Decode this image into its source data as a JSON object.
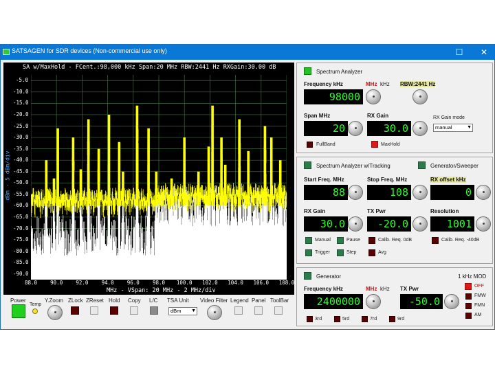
{
  "window": {
    "title": "SATSAGEN for SDR devices (Non-commercial use only)"
  },
  "colors": {
    "titlebar": "#0a78d7",
    "trace_maxhold": "#ffff00",
    "trace_live": "#ffffff",
    "grid": "#3a6e3a",
    "lcd_text": "#2cff2c",
    "accent_red": "#d01010"
  },
  "scope": {
    "title": "SA w/MaxHold - FCent.:98,000 kHz Span:20 MHz RBW:2441 Hz RXGain:30.00 dB",
    "y_axis_title": "dBm - 5 dBm/div",
    "x_axis_title": "MHz - VSpan: 20 MHz - 2 MHz/div",
    "y_ticks": [
      "-5.0",
      "-10.0",
      "-15.0",
      "-20.0",
      "-25.0",
      "-30.0",
      "-35.0",
      "-40.0",
      "-45.0",
      "-50.0",
      "-55.0",
      "-60.0",
      "-65.0",
      "-70.0",
      "-75.0",
      "-80.0",
      "-85.0",
      "-90.0"
    ],
    "x_ticks": [
      "88.0",
      "90.0",
      "92.0",
      "94.0",
      "96.0",
      "98.0",
      "100.0",
      "102.0",
      "104.0",
      "106.0",
      "108.0"
    ]
  },
  "chart_data": {
    "type": "line",
    "title": "SA w/MaxHold - FCent.:98,000 kHz Span:20 MHz RBW:2441 Hz RXGain:30.00 dB",
    "xlabel": "MHz - VSpan: 20 MHz - 2 MHz/div",
    "ylabel": "dBm - 5 dBm/div",
    "xlim": [
      88.0,
      108.0
    ],
    "ylim": [
      -92.5,
      -2.5
    ],
    "grid": true,
    "series": [
      {
        "values_x": [
          88.0,
          89.2,
          89.8,
          90.1,
          90.5,
          91.3,
          91.9,
          92.5,
          93.3,
          94.1,
          94.9,
          95.2,
          96.3,
          97.2,
          97.8,
          98.3,
          99.0,
          100.0,
          101.1,
          101.9,
          102.2,
          102.9,
          103.2,
          104.3,
          105.0,
          106.3,
          106.8,
          107.5,
          108.0
        ],
        "values_y": [
          -55,
          -40,
          -48,
          -26,
          -55,
          -30,
          -44,
          -22,
          -35,
          -20,
          -32,
          -45,
          -16,
          -26,
          -45,
          -56,
          -48,
          -30,
          -45,
          -34,
          -16,
          -30,
          -42,
          -22,
          -36,
          -25,
          -30,
          -40,
          -58
        ]
      }
    ]
  },
  "toolbar": {
    "items": [
      {
        "label": "Power"
      },
      {
        "label": "Temp"
      },
      {
        "label": "Y.Zoom"
      },
      {
        "label": "ZLock"
      },
      {
        "label": "ZReset"
      },
      {
        "label": "Hold"
      },
      {
        "label": "Copy"
      },
      {
        "label": "L/C"
      },
      {
        "label": "TSA Unit"
      },
      {
        "label": "Video Filter"
      },
      {
        "label": "Legend"
      },
      {
        "label": "Panel"
      },
      {
        "label": "ToolBar"
      }
    ],
    "tsa_unit_value": "dBm"
  },
  "spectrum_analyzer": {
    "title": "Spectrum Analyzer",
    "freq_label": "Frequency kHz",
    "unit_mhz": "MHz",
    "unit_khz": "kHz",
    "rbw_label": "RBW:2441 Hz",
    "freq_value": "98000",
    "span_label": "Span MHz",
    "span_value": "20",
    "rxgain_label": "RX Gain",
    "rxgain_value": "30.0",
    "rxgain_mode_label": "RX Gain mode",
    "rxgain_mode_value": "manual",
    "fullband_label": "FullBand",
    "maxhold_label": "MaxHold"
  },
  "tracking": {
    "title": "Spectrum Analyzer w/Tracking",
    "gen_title": "Generator/Sweeper",
    "start_label": "Start Freq. MHz",
    "start_value": "88",
    "stop_label": "Stop Freq. MHz",
    "stop_value": "108",
    "rxoffset_label": "RX offset kHz",
    "rxoffset_value": "0",
    "rxgain_label": "RX Gain",
    "rxgain_value": "30.0",
    "txpwr_label": "TX Pwr",
    "txpwr_value": "-20.0",
    "resolution_label": "Resolution",
    "resolution_value": "1001",
    "manual_label": "Manual",
    "pause_label": "Pause",
    "calib_0_label": "Calib. Req. 0dB",
    "calib_40_label": "Calib. Req. -40dB",
    "trigger_label": "Trigger",
    "step_label": "Step",
    "avg_label": "Avg"
  },
  "generator": {
    "title": "Generator",
    "mod_label": "1 kHz MOD",
    "freq_label": "Frequency kHz",
    "unit_mhz": "MHz",
    "unit_khz": "kHz",
    "freq_value": "2400000",
    "txpwr_label": "TX Pwr",
    "txpwr_value": "-50.0",
    "mod_options": [
      "OFF",
      "FMW",
      "FMN",
      "AM"
    ],
    "harmonics": [
      "3rd",
      "5rd",
      "7rd",
      "9rd"
    ]
  }
}
